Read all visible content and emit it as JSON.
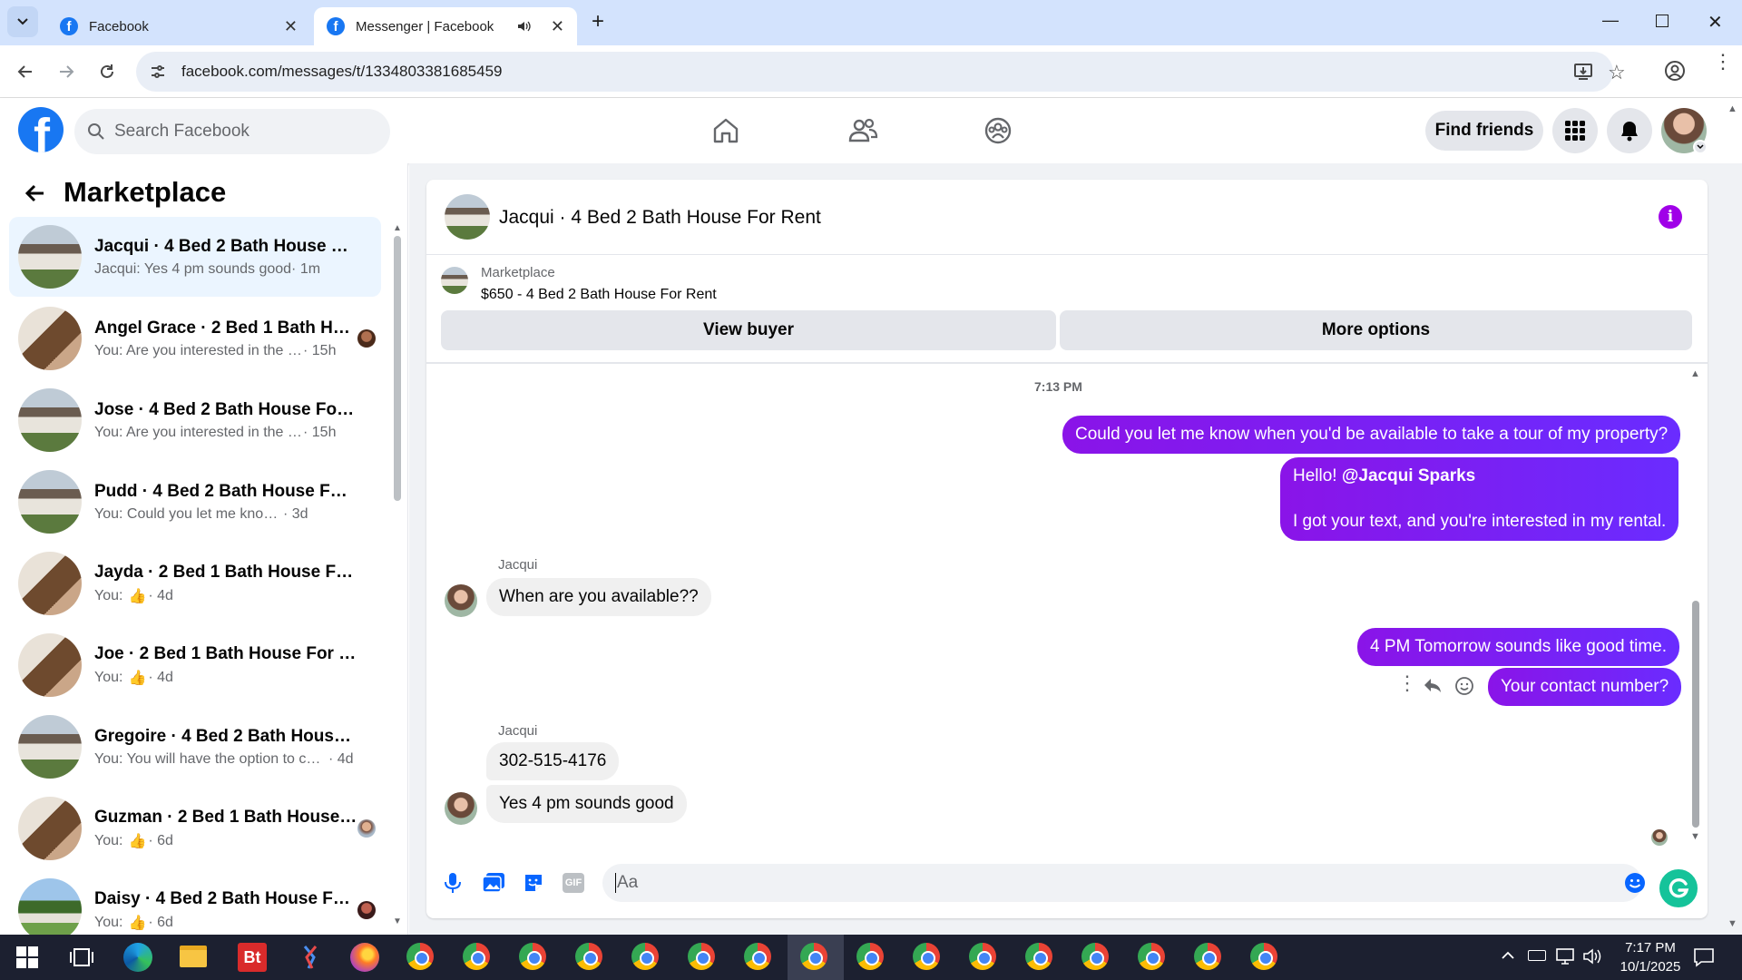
{
  "browser": {
    "tabs": [
      {
        "title": "Facebook"
      },
      {
        "title": "Messenger | Facebook"
      }
    ],
    "url": "facebook.com/messages/t/1334803381685459"
  },
  "header": {
    "search_placeholder": "Search Facebook",
    "find_friends": "Find friends"
  },
  "left": {
    "title": "Marketplace",
    "conversations": [
      {
        "name": "Jacqui · 4 Bed 2 Bath House For Rent",
        "preview": "Jacqui: Yes 4 pm sounds good",
        "time": "· 1m"
      },
      {
        "name": "Angel Grace · 2 Bed 1 Bath House For Rent",
        "preview": "You: Are you interested in the unit?",
        "time": "· 15h"
      },
      {
        "name": "Jose · 4 Bed 2 Bath House For Rent",
        "preview": "You: Are you interested in the unit?",
        "time": "· 15h"
      },
      {
        "name": "Pudd · 4 Bed 2 Bath House For Rent",
        "preview": "You: Could you let me know when you'd be available",
        "time": "· 3d"
      },
      {
        "name": "Jayda · 2 Bed 1 Bath House For Rent",
        "preview": "You:",
        "time": "· 4d"
      },
      {
        "name": "Joe · 2 Bed 1 Bath House For Rent",
        "preview": "You:",
        "time": "· 4d"
      },
      {
        "name": "Gregoire · 4 Bed 2 Bath House For Rent",
        "preview": "You: You will have the option to choose",
        "time": "· 4d"
      },
      {
        "name": "Guzman · 2 Bed 1 Bath House For Rent",
        "preview": "You:",
        "time": "· 6d"
      },
      {
        "name": "Daisy · 4 Bed 2 Bath House For Rent",
        "preview": "You:",
        "time": "· 6d"
      }
    ]
  },
  "chat": {
    "title": "Jacqui · 4 Bed 2 Bath House For Rent",
    "listing_source": "Marketplace",
    "listing": "$650 - 4 Bed 2 Bath House For Rent",
    "view_buyer": "View buyer",
    "more_options": "More options",
    "timestamp": "7:13 PM",
    "messages": {
      "m1": "Could you let me know when you'd be available to take a tour of my property?",
      "m2_greeting": "Hello! ",
      "m2_mention": "@Jacqui Sparks",
      "m2_body": "I got your text, and you're interested in my rental.",
      "sender1": "Jacqui",
      "m3": "When are you available??",
      "m4": "4 PM Tomorrow sounds like good time.",
      "m5": "Your contact number?",
      "sender2": "Jacqui",
      "m6": "302-515-4176",
      "m7": "Yes 4 pm sounds good"
    },
    "composer_placeholder": "Aa"
  },
  "taskbar": {
    "time": "7:17 PM",
    "date": "10/1/2025"
  },
  "colors": {
    "fb_blue": "#1877f2",
    "message_purple": "#7a1fff",
    "info_purple": "#a000e8"
  }
}
